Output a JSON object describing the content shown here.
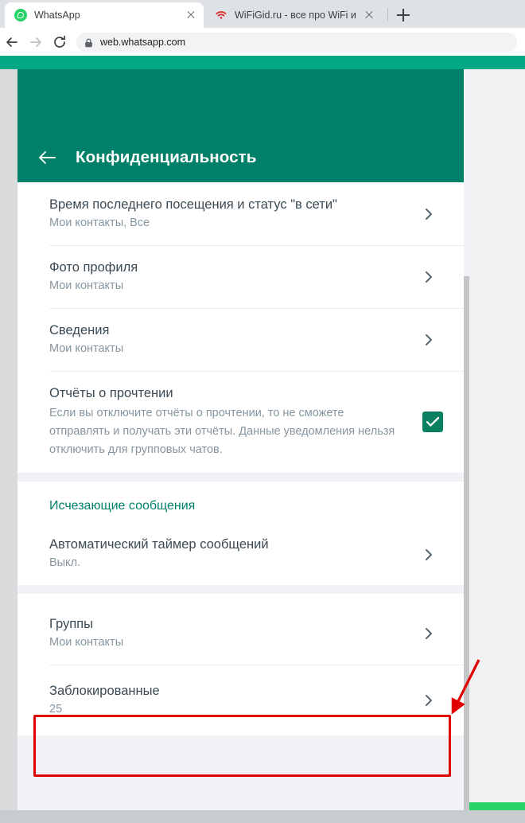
{
  "browser": {
    "tabs": [
      {
        "title": "WhatsApp",
        "favicon": "whatsapp-icon",
        "active": true
      },
      {
        "title": "WiFiGid.ru - все про WiFi и бесп",
        "favicon": "wifi-icon",
        "active": false
      }
    ],
    "new_tab_label": "+",
    "toolbar": {
      "back_icon": "back-arrow-icon",
      "forward_icon": "forward-arrow-icon",
      "reload_icon": "reload-icon",
      "lock_icon": "lock-icon",
      "url": "web.whatsapp.com"
    }
  },
  "colors": {
    "header_green": "#008069",
    "band_green": "#00a884",
    "accent_green": "#25d366",
    "checkbox_green": "#0a8060",
    "section_label": "#008069",
    "annotation_red": "#e00000",
    "title_text": "#3b4a54",
    "sub_text": "#8696a0"
  },
  "panel": {
    "back_icon": "back-arrow-icon",
    "title": "Конфиденциальность",
    "groups": [
      {
        "rows": [
          {
            "title": "Время последнего посещения и статус \"в сети\"",
            "sub": "Мои контакты, Все",
            "control": "chevron"
          },
          {
            "title": "Фото профиля",
            "sub": "Мои контакты",
            "control": "chevron"
          },
          {
            "title": "Сведения",
            "sub": "Мои контакты",
            "control": "chevron"
          },
          {
            "title": "Отчёты о прочтении",
            "desc": "Если вы отключите отчёты о прочтении, то не сможете отправлять и получать эти отчёты. Данные уведомления нельзя отключить для групповых чатов.",
            "control": "checkbox",
            "checked": true
          }
        ]
      },
      {
        "section_label": "Исчезающие сообщения",
        "rows": [
          {
            "title": "Автоматический таймер сообщений",
            "sub": "Выкл.",
            "control": "chevron"
          }
        ]
      },
      {
        "rows": [
          {
            "title": "Группы",
            "sub": "Мои контакты",
            "control": "chevron"
          },
          {
            "title": "Заблокированные",
            "sub": "25",
            "control": "chevron",
            "highlighted": true
          }
        ]
      }
    ]
  },
  "annotation": {
    "box_target": "Заблокированные",
    "arrow": "red-arrow-annotation"
  }
}
